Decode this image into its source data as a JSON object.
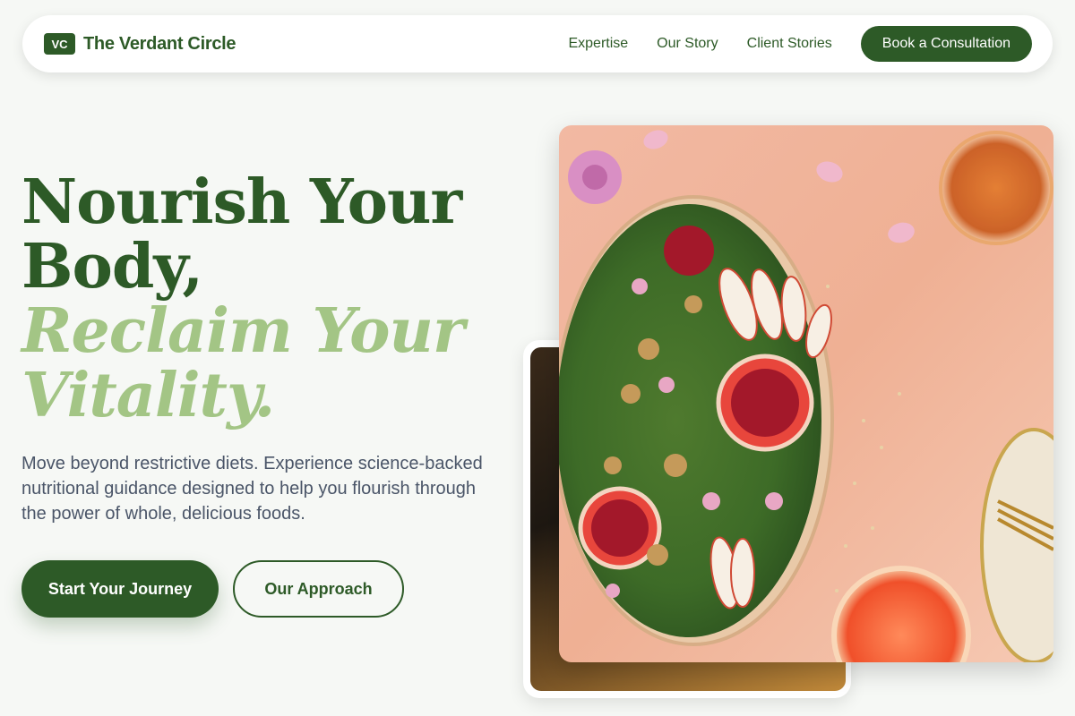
{
  "brand": {
    "logo_text": "VC",
    "name": "The Verdant Circle"
  },
  "nav": {
    "links": [
      "Expertise",
      "Our Story",
      "Client Stories"
    ],
    "cta": "Book a Consultation"
  },
  "hero": {
    "headline_line1": "Nourish Your",
    "headline_line2": "Body,",
    "headline_line3": "Reclaim Your",
    "headline_line4": "Vitality.",
    "lede": "Move beyond restrictive diets. Experience science-backed nutritional guidance designed to help you flourish through the power of whole, delicious foods.",
    "primary_button": "Start Your Journey",
    "secondary_button": "Our Approach"
  },
  "colors": {
    "brand_green": "#2d5a27",
    "accent_green": "#a3c585",
    "page_bg": "#f6f8f5",
    "body_text": "#4a5568"
  }
}
